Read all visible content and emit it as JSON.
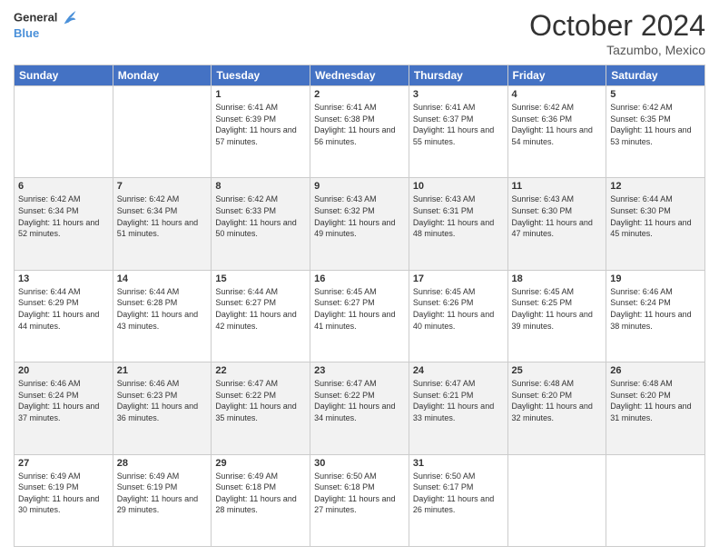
{
  "header": {
    "logo": {
      "line1": "General",
      "line2": "Blue"
    },
    "title": "October 2024",
    "location": "Tazumbo, Mexico"
  },
  "days_of_week": [
    "Sunday",
    "Monday",
    "Tuesday",
    "Wednesday",
    "Thursday",
    "Friday",
    "Saturday"
  ],
  "weeks": [
    [
      {
        "day": "",
        "sunrise": "",
        "sunset": "",
        "daylight": ""
      },
      {
        "day": "",
        "sunrise": "",
        "sunset": "",
        "daylight": ""
      },
      {
        "day": "1",
        "sunrise": "Sunrise: 6:41 AM",
        "sunset": "Sunset: 6:39 PM",
        "daylight": "Daylight: 11 hours and 57 minutes."
      },
      {
        "day": "2",
        "sunrise": "Sunrise: 6:41 AM",
        "sunset": "Sunset: 6:38 PM",
        "daylight": "Daylight: 11 hours and 56 minutes."
      },
      {
        "day": "3",
        "sunrise": "Sunrise: 6:41 AM",
        "sunset": "Sunset: 6:37 PM",
        "daylight": "Daylight: 11 hours and 55 minutes."
      },
      {
        "day": "4",
        "sunrise": "Sunrise: 6:42 AM",
        "sunset": "Sunset: 6:36 PM",
        "daylight": "Daylight: 11 hours and 54 minutes."
      },
      {
        "day": "5",
        "sunrise": "Sunrise: 6:42 AM",
        "sunset": "Sunset: 6:35 PM",
        "daylight": "Daylight: 11 hours and 53 minutes."
      }
    ],
    [
      {
        "day": "6",
        "sunrise": "Sunrise: 6:42 AM",
        "sunset": "Sunset: 6:34 PM",
        "daylight": "Daylight: 11 hours and 52 minutes."
      },
      {
        "day": "7",
        "sunrise": "Sunrise: 6:42 AM",
        "sunset": "Sunset: 6:34 PM",
        "daylight": "Daylight: 11 hours and 51 minutes."
      },
      {
        "day": "8",
        "sunrise": "Sunrise: 6:42 AM",
        "sunset": "Sunset: 6:33 PM",
        "daylight": "Daylight: 11 hours and 50 minutes."
      },
      {
        "day": "9",
        "sunrise": "Sunrise: 6:43 AM",
        "sunset": "Sunset: 6:32 PM",
        "daylight": "Daylight: 11 hours and 49 minutes."
      },
      {
        "day": "10",
        "sunrise": "Sunrise: 6:43 AM",
        "sunset": "Sunset: 6:31 PM",
        "daylight": "Daylight: 11 hours and 48 minutes."
      },
      {
        "day": "11",
        "sunrise": "Sunrise: 6:43 AM",
        "sunset": "Sunset: 6:30 PM",
        "daylight": "Daylight: 11 hours and 47 minutes."
      },
      {
        "day": "12",
        "sunrise": "Sunrise: 6:44 AM",
        "sunset": "Sunset: 6:30 PM",
        "daylight": "Daylight: 11 hours and 45 minutes."
      }
    ],
    [
      {
        "day": "13",
        "sunrise": "Sunrise: 6:44 AM",
        "sunset": "Sunset: 6:29 PM",
        "daylight": "Daylight: 11 hours and 44 minutes."
      },
      {
        "day": "14",
        "sunrise": "Sunrise: 6:44 AM",
        "sunset": "Sunset: 6:28 PM",
        "daylight": "Daylight: 11 hours and 43 minutes."
      },
      {
        "day": "15",
        "sunrise": "Sunrise: 6:44 AM",
        "sunset": "Sunset: 6:27 PM",
        "daylight": "Daylight: 11 hours and 42 minutes."
      },
      {
        "day": "16",
        "sunrise": "Sunrise: 6:45 AM",
        "sunset": "Sunset: 6:27 PM",
        "daylight": "Daylight: 11 hours and 41 minutes."
      },
      {
        "day": "17",
        "sunrise": "Sunrise: 6:45 AM",
        "sunset": "Sunset: 6:26 PM",
        "daylight": "Daylight: 11 hours and 40 minutes."
      },
      {
        "day": "18",
        "sunrise": "Sunrise: 6:45 AM",
        "sunset": "Sunset: 6:25 PM",
        "daylight": "Daylight: 11 hours and 39 minutes."
      },
      {
        "day": "19",
        "sunrise": "Sunrise: 6:46 AM",
        "sunset": "Sunset: 6:24 PM",
        "daylight": "Daylight: 11 hours and 38 minutes."
      }
    ],
    [
      {
        "day": "20",
        "sunrise": "Sunrise: 6:46 AM",
        "sunset": "Sunset: 6:24 PM",
        "daylight": "Daylight: 11 hours and 37 minutes."
      },
      {
        "day": "21",
        "sunrise": "Sunrise: 6:46 AM",
        "sunset": "Sunset: 6:23 PM",
        "daylight": "Daylight: 11 hours and 36 minutes."
      },
      {
        "day": "22",
        "sunrise": "Sunrise: 6:47 AM",
        "sunset": "Sunset: 6:22 PM",
        "daylight": "Daylight: 11 hours and 35 minutes."
      },
      {
        "day": "23",
        "sunrise": "Sunrise: 6:47 AM",
        "sunset": "Sunset: 6:22 PM",
        "daylight": "Daylight: 11 hours and 34 minutes."
      },
      {
        "day": "24",
        "sunrise": "Sunrise: 6:47 AM",
        "sunset": "Sunset: 6:21 PM",
        "daylight": "Daylight: 11 hours and 33 minutes."
      },
      {
        "day": "25",
        "sunrise": "Sunrise: 6:48 AM",
        "sunset": "Sunset: 6:20 PM",
        "daylight": "Daylight: 11 hours and 32 minutes."
      },
      {
        "day": "26",
        "sunrise": "Sunrise: 6:48 AM",
        "sunset": "Sunset: 6:20 PM",
        "daylight": "Daylight: 11 hours and 31 minutes."
      }
    ],
    [
      {
        "day": "27",
        "sunrise": "Sunrise: 6:49 AM",
        "sunset": "Sunset: 6:19 PM",
        "daylight": "Daylight: 11 hours and 30 minutes."
      },
      {
        "day": "28",
        "sunrise": "Sunrise: 6:49 AM",
        "sunset": "Sunset: 6:19 PM",
        "daylight": "Daylight: 11 hours and 29 minutes."
      },
      {
        "day": "29",
        "sunrise": "Sunrise: 6:49 AM",
        "sunset": "Sunset: 6:18 PM",
        "daylight": "Daylight: 11 hours and 28 minutes."
      },
      {
        "day": "30",
        "sunrise": "Sunrise: 6:50 AM",
        "sunset": "Sunset: 6:18 PM",
        "daylight": "Daylight: 11 hours and 27 minutes."
      },
      {
        "day": "31",
        "sunrise": "Sunrise: 6:50 AM",
        "sunset": "Sunset: 6:17 PM",
        "daylight": "Daylight: 11 hours and 26 minutes."
      },
      {
        "day": "",
        "sunrise": "",
        "sunset": "",
        "daylight": ""
      },
      {
        "day": "",
        "sunrise": "",
        "sunset": "",
        "daylight": ""
      }
    ]
  ]
}
